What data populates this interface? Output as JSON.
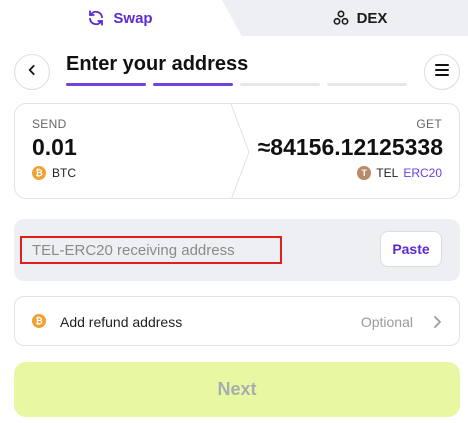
{
  "tabs": [
    {
      "label": "Swap",
      "icon": "refresh-icon",
      "active": true
    },
    {
      "label": "DEX",
      "icon": "dex-circles-icon",
      "active": false
    }
  ],
  "header": {
    "title": "Enter your address",
    "progress": {
      "total_steps": 4,
      "completed_steps": 2
    }
  },
  "exchange": {
    "send": {
      "label": "SEND",
      "amount": "0.01",
      "currency": "BTC",
      "coin_letter": "₿"
    },
    "get": {
      "label": "GET",
      "amount": "≈84156.12125338",
      "currency": "TEL",
      "network": "ERC20",
      "coin_letter": "T"
    }
  },
  "address": {
    "placeholder": "TEL-ERC20 receiving address",
    "value": "",
    "paste_label": "Paste"
  },
  "refund": {
    "label": "Add refund address",
    "optional_label": "Optional",
    "coin_letter": "₿"
  },
  "next_label": "Next",
  "colors": {
    "accent": "#5b2ad1",
    "next_bg": "#e8f7a1",
    "highlight_border": "#e0201f",
    "btc": "#f3a033",
    "tel": "#b88a6a"
  }
}
